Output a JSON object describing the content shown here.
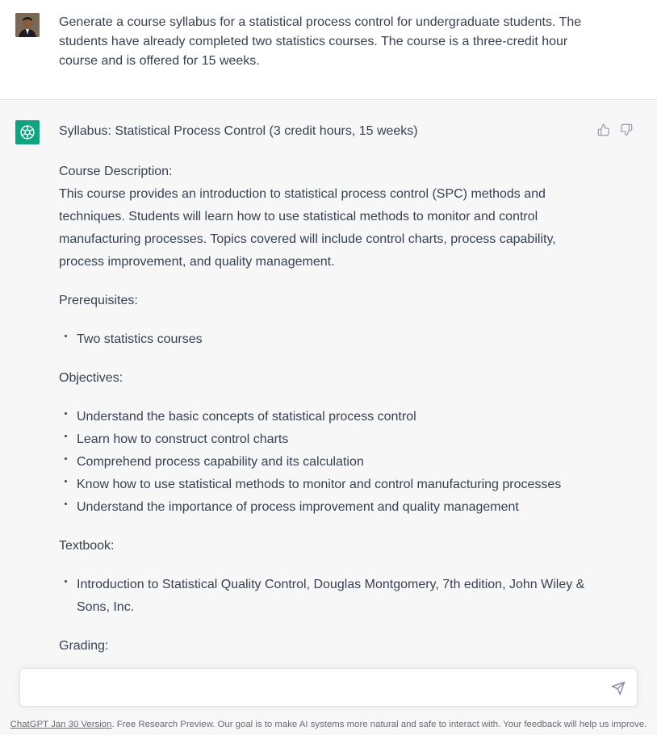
{
  "user_message": {
    "avatar_icon": "user-avatar",
    "text": "Generate a course syllabus for a statistical process control for undergraduate students. The students have already completed two statistics courses. The course is a three-credit hour course and is offered for 15 weeks."
  },
  "assistant_message": {
    "logo_icon": "chatgpt-logo",
    "title": "Syllabus: Statistical Process Control (3 credit hours, 15 weeks)",
    "course_description_heading": "Course Description:",
    "course_description_text": "This course provides an introduction to statistical process control (SPC) methods and techniques. Students will learn how to use statistical methods to monitor and control manufacturing processes. Topics covered will include control charts, process capability, process improvement, and quality management.",
    "prerequisites_heading": "Prerequisites:",
    "prerequisites": [
      "Two statistics courses"
    ],
    "objectives_heading": "Objectives:",
    "objectives": [
      "Understand the basic concepts of statistical process control",
      "Learn how to construct control charts",
      "Comprehend process capability and its calculation",
      "Know how to use statistical methods to monitor and control manufacturing processes",
      "Understand the importance of process improvement and quality management"
    ],
    "textbook_heading": "Textbook:",
    "textbook": [
      "Introduction to Statistical Quality Control, Douglas Montgomery, 7th edition, John Wiley & Sons, Inc."
    ],
    "grading_heading": "Grading:",
    "feedback_icons": [
      "thumbs-up-icon",
      "thumbs-down-icon"
    ]
  },
  "composer": {
    "value": "",
    "placeholder": "",
    "send_icon": "send-icon"
  },
  "footer": {
    "link_text": "ChatGPT Jan 30 Version",
    "text": ". Free Research Preview. Our goal is to make AI systems more natural and safe to interact with. Your feedback will help us improve."
  },
  "colors": {
    "accent": "#10a37f",
    "assistant_bg": "#f7f7f8",
    "text": "#374151"
  }
}
